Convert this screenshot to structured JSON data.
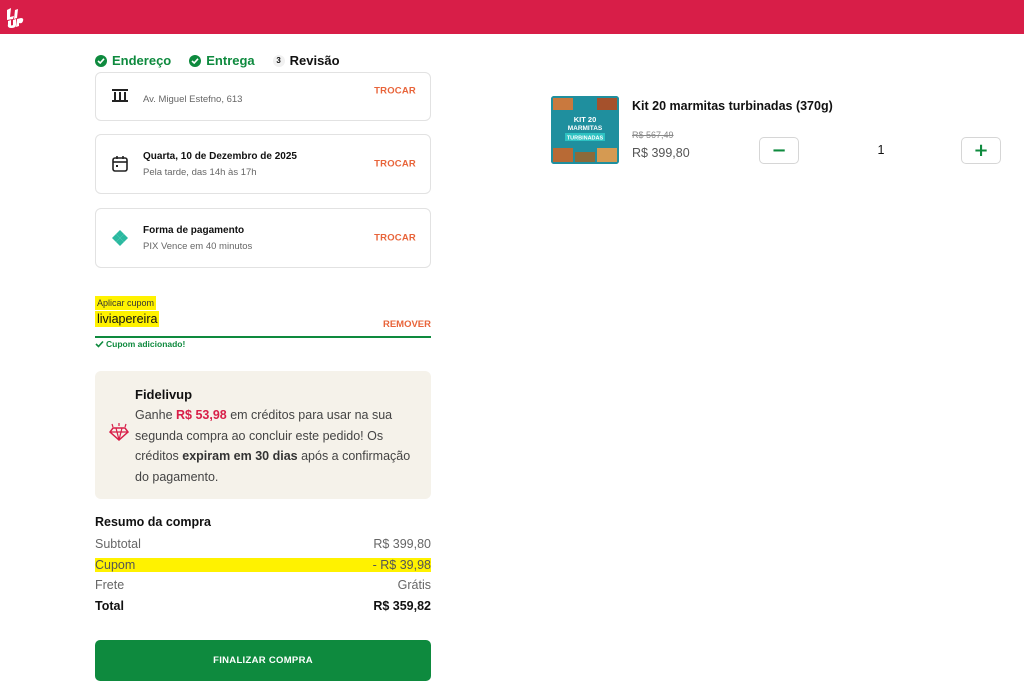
{
  "steps": [
    {
      "label": "Endereço",
      "state": "done"
    },
    {
      "label": "Entrega",
      "state": "done"
    },
    {
      "label": "Revisão",
      "state": "current",
      "number": "3"
    }
  ],
  "address": {
    "line": "Av. Miguel Estefno, 613",
    "action": "TROCAR"
  },
  "delivery": {
    "date": "Quarta, 10 de Dezembro de 2025",
    "period": "Pela tarde, das 14h às 17h",
    "action": "TROCAR"
  },
  "payment": {
    "title": "Forma de pagamento",
    "detail": "PIX  Vence em 40 minutos",
    "action": "TROCAR"
  },
  "coupon": {
    "label": "Aplicar cupom",
    "value": "liviapereira",
    "remove": "REMOVER",
    "success": "Cupom adicionado!"
  },
  "fidelivup": {
    "title": "Fidelivup",
    "text_1": "Ganhe ",
    "amount": "R$ 53,98",
    "text_2": " em créditos para usar na sua segunda compra ao concluir este pedido! Os créditos ",
    "expire": "expiram em 30 dias",
    "text_3": " após a confirmação do pagamento."
  },
  "summary": {
    "title": "Resumo da compra",
    "subtotal_label": "Subtotal",
    "subtotal_value": "R$ 399,80",
    "coupon_label": "Cupom",
    "coupon_value": "- R$ 39,98",
    "shipping_label": "Frete",
    "shipping_value": "Grátis",
    "total_label": "Total",
    "total_value": "R$ 359,82"
  },
  "finalize_label": "FINALIZAR COMPRA",
  "product": {
    "name": "Kit 20 marmitas turbinadas (370g)",
    "old_price": "R$ 567,49",
    "price": "R$ 399,80",
    "quantity": "1",
    "minus": "−",
    "plus": "+",
    "image_text_1": "KIT 20",
    "image_text_2": "MARMITAS",
    "image_text_3": "TURBINADAS"
  },
  "colors": {
    "brand": "#d81e48",
    "accent": "#0e8a3e",
    "action": "#e8643a",
    "highlight": "#fff200"
  }
}
